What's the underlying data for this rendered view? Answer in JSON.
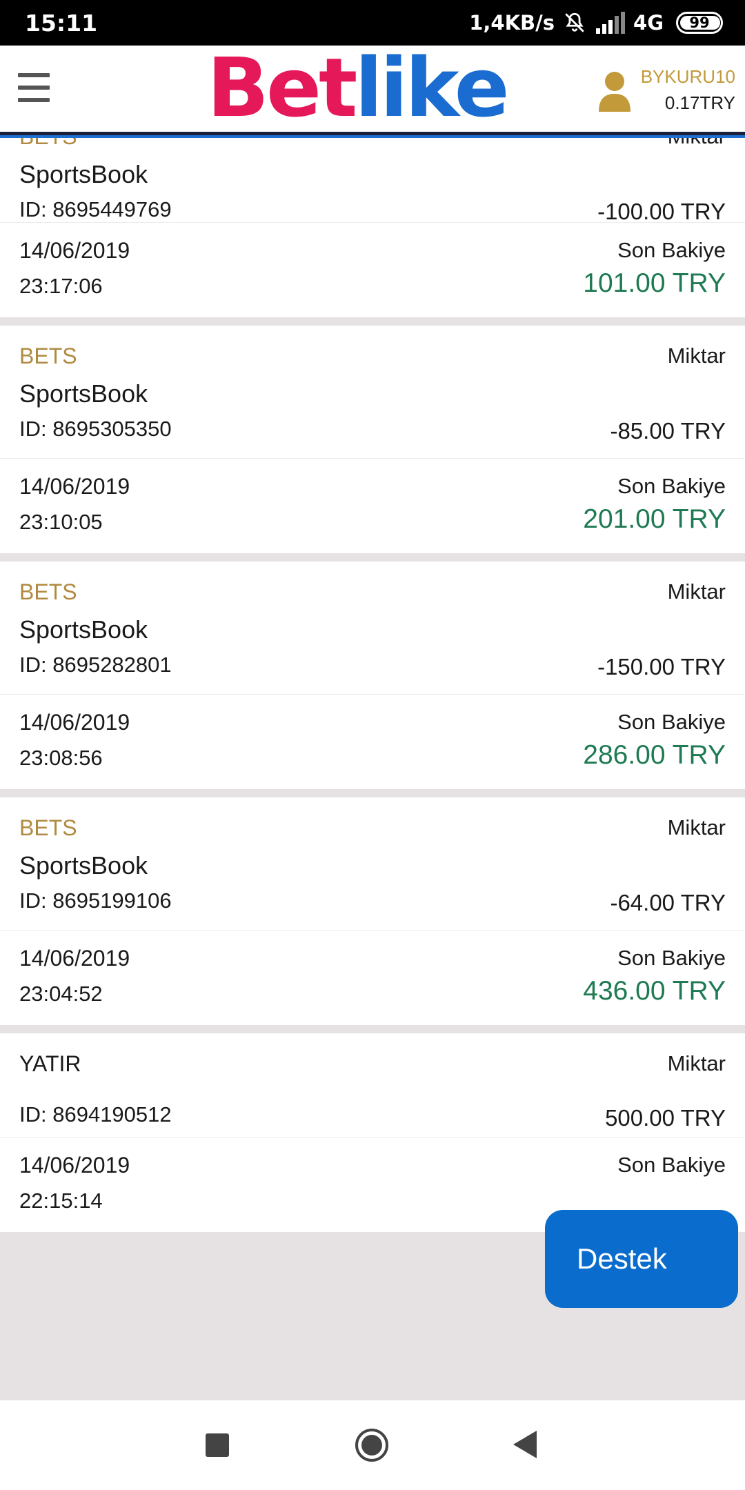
{
  "status_bar": {
    "time": "15:11",
    "speed": "1,4KB/s",
    "network": "4G",
    "battery": "99"
  },
  "header": {
    "logo_part1": "Bet",
    "logo_part2": "like",
    "username": "BYKURU10",
    "balance": "0.17TRY"
  },
  "labels": {
    "amount": "Miktar",
    "last_balance": "Son Bakiye"
  },
  "transactions": [
    {
      "type": "BETS",
      "game": "SportsBook",
      "id": "ID: 8695449769",
      "amount": "-100.00 TRY",
      "date": "14/06/2019",
      "time": "23:17:06",
      "balance": "101.00 TRY"
    },
    {
      "type": "BETS",
      "game": "SportsBook",
      "id": "ID: 8695305350",
      "amount": "-85.00 TRY",
      "date": "14/06/2019",
      "time": "23:10:05",
      "balance": "201.00 TRY"
    },
    {
      "type": "BETS",
      "game": "SportsBook",
      "id": "ID: 8695282801",
      "amount": "-150.00 TRY",
      "date": "14/06/2019",
      "time": "23:08:56",
      "balance": "286.00 TRY"
    },
    {
      "type": "BETS",
      "game": "SportsBook",
      "id": "ID: 8695199106",
      "amount": "-64.00 TRY",
      "date": "14/06/2019",
      "time": "23:04:52",
      "balance": "436.00 TRY"
    },
    {
      "type": "YATIR",
      "game": "",
      "id": "ID: 8694190512",
      "amount": "500.00 TRY",
      "date": "14/06/2019",
      "time": "22:15:14",
      "balance": ""
    }
  ],
  "support_button": "Destek",
  "colors": {
    "accent_gold": "#b08a40",
    "balance_green": "#1e7a52",
    "support_blue": "#0a6ccc",
    "logo_pink": "#e5185a",
    "logo_blue": "#1a6cd0"
  }
}
